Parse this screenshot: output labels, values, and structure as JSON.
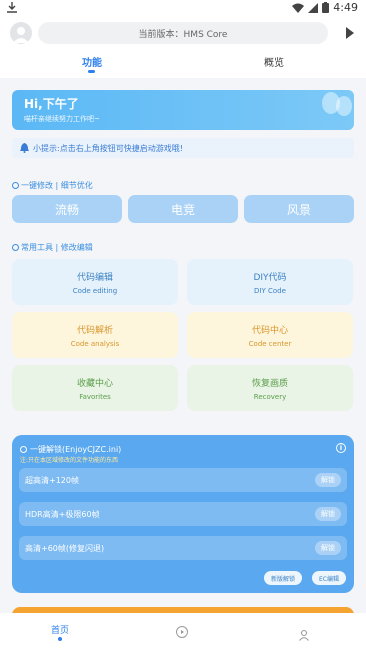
{
  "status_bar": {
    "time": "4:49"
  },
  "header": {
    "version_label": "当前版本：HMS Core"
  },
  "tabs": [
    {
      "label": "功能"
    },
    {
      "label": "概览"
    }
  ],
  "banner": {
    "title": "Hi,下午了",
    "subtitle": "喵杆亲继续努力工作吧~"
  },
  "notice": {
    "text": "小提示:点击右上角按钮可快捷启动游戏哦!"
  },
  "quick_section": {
    "title": "一键修改 | 细节优化",
    "modes": [
      {
        "label": "流畅"
      },
      {
        "label": "电竞"
      },
      {
        "label": "风景"
      }
    ]
  },
  "tools_section": {
    "title": "常用工具 | 修改编辑",
    "tools": [
      {
        "title": "代码编辑",
        "subtitle": "Code editing",
        "color": "#3b82c4"
      },
      {
        "title": "DIY代码",
        "subtitle": "DIY Code",
        "color": "#3b82c4"
      },
      {
        "title": "代码解析",
        "subtitle": "Code analysis",
        "color": "#d9952c"
      },
      {
        "title": "代码中心",
        "subtitle": "Code center",
        "color": "#d9952c"
      },
      {
        "title": "收藏中心",
        "subtitle": "Favorites",
        "color": "#5a9e4a"
      },
      {
        "title": "恢复画质",
        "subtitle": "Recovery",
        "color": "#5a9e4a"
      }
    ]
  },
  "unlock_panel": {
    "title": "一键解锁(EnjoyCJZC.ini)",
    "subtitle": "注:只在本区域修改的文件功能的东西",
    "presets": [
      {
        "label": "超高清+120帧",
        "button": "解锁"
      },
      {
        "label": "HDR高清+极限60帧",
        "button": "解锁"
      },
      {
        "label": "高清+60帧(修复闪退)",
        "button": "解锁"
      }
    ],
    "footer_buttons": [
      {
        "label": "新版解锁"
      },
      {
        "label": "EC编辑"
      }
    ]
  },
  "bottom_nav": {
    "home_label": "首页"
  },
  "colors": {
    "accent": "#2f80ed",
    "mode_button": "#a9d2f6",
    "unlock_panel": "#5aa8ef"
  }
}
